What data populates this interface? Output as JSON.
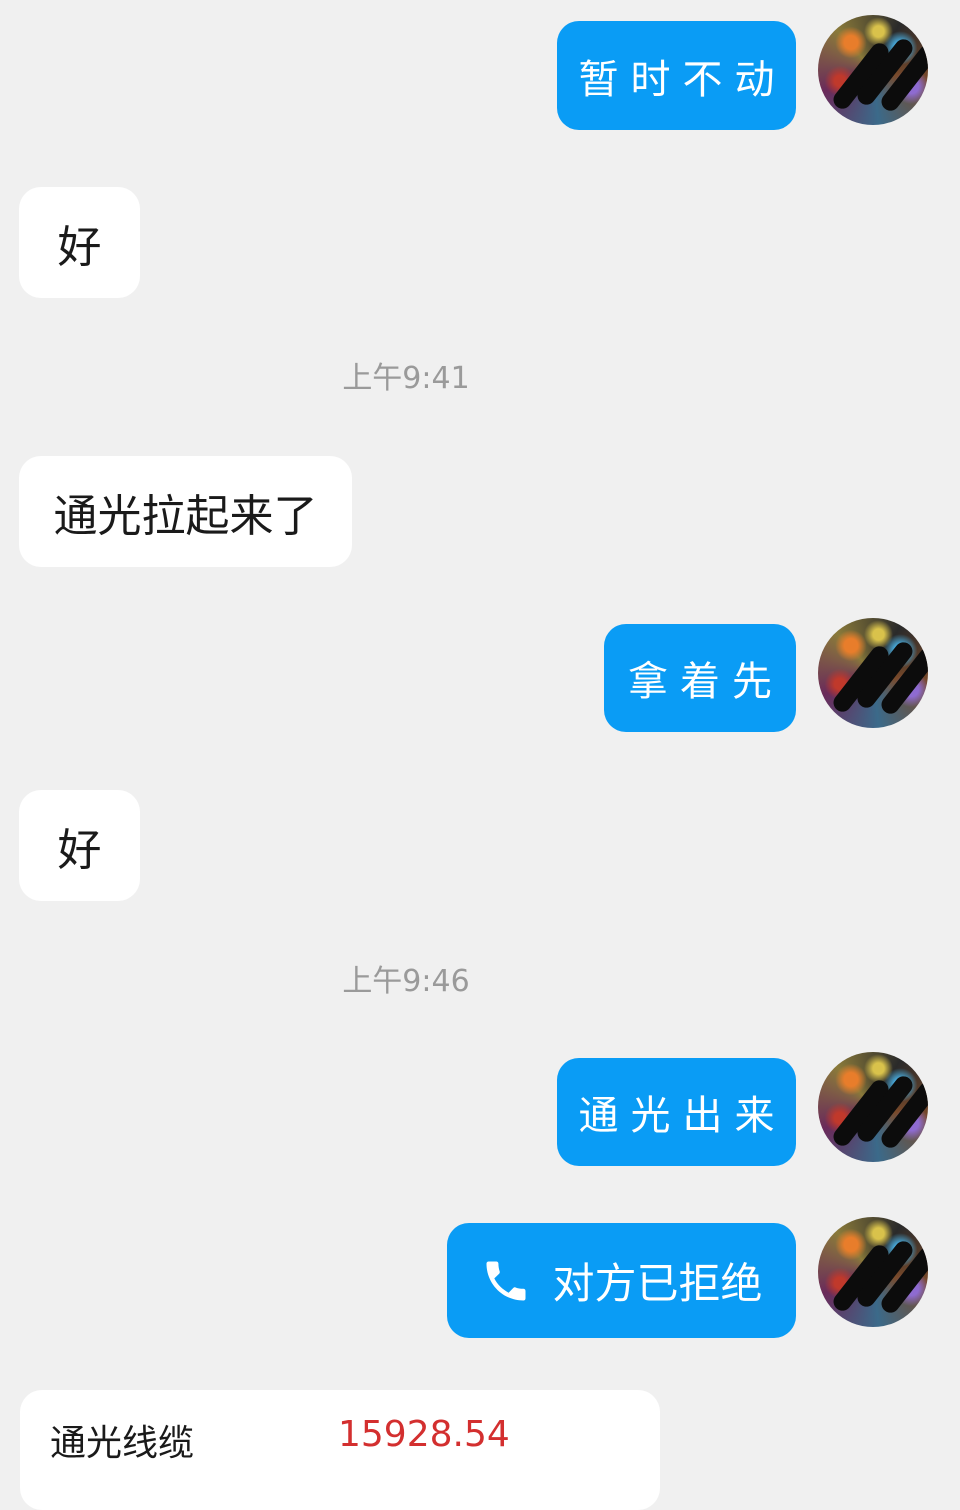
{
  "messages": [
    {
      "side": "out",
      "text": "暂时不动"
    },
    {
      "side": "in",
      "text": "好"
    },
    {
      "timestamp": "上午9:41"
    },
    {
      "side": "in",
      "text": "通光拉起来了"
    },
    {
      "side": "out",
      "text": "拿着先"
    },
    {
      "side": "in",
      "text": "好"
    },
    {
      "timestamp": "上午9:46"
    },
    {
      "side": "out",
      "text": "通光出来"
    },
    {
      "side": "out",
      "type": "call",
      "icon": "phone-icon",
      "text": "对方已拒绝"
    }
  ],
  "stock_card": {
    "name": "通光线缆",
    "value": "15928.54"
  },
  "colors": {
    "background": "#f0f0f0",
    "outgoing_bubble": "#0a9cf5",
    "incoming_bubble": "#ffffff",
    "timestamp_text": "#9a9a9a",
    "card_value": "#d32f2f"
  }
}
